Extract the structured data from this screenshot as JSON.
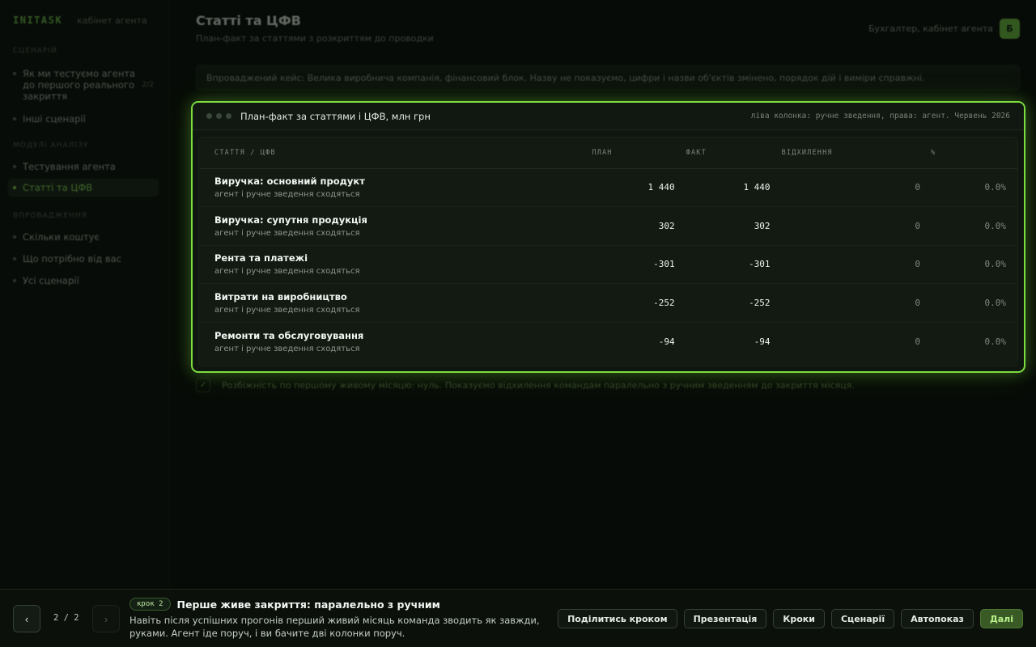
{
  "brand": {
    "logo": "INITASK",
    "subtitle": "кабінет агента"
  },
  "sidebar": {
    "sections": [
      {
        "label": "сценарій"
      },
      {
        "label": "модулі аналізу"
      },
      {
        "label": "впровадження"
      }
    ],
    "items": [
      {
        "label": "Як ми тестуємо агента до першого реального закриття",
        "meta": "2/2"
      },
      {
        "label": "Інші сценарії"
      },
      {
        "label": "Тестування агента"
      },
      {
        "label": "Статті та ЦФВ"
      },
      {
        "label": "Скільки коштує"
      },
      {
        "label": "Що потрібно від вас"
      },
      {
        "label": "Усі сценарії"
      }
    ]
  },
  "header": {
    "title": "Статті та ЦФВ",
    "subtitle": "План-факт за статтями з розкриттям до проводки",
    "user_label": "Бухгалтер, кабінет агента",
    "avatar": "Б"
  },
  "banner": "Впроваджений кейс: Велика виробнича компанія, фінансовий блок. Назву не показуємо, цифри і назви об'єктів змінено, порядок дій і виміри справжні.",
  "card": {
    "title": "План-факт за статтями і ЦФВ, млн грн",
    "note": "ліва колонка: ручне зведення, права: агент. Червень 2026",
    "columns": {
      "name": "СТАТТЯ / ЦФВ",
      "plan": "ПЛАН",
      "fact": "ФАКТ",
      "variance": "ВІДХИЛЕННЯ",
      "percent": "%"
    },
    "rows": [
      {
        "title": "Виручка: основний продукт",
        "sub": "агент і ручне зведення сходяться",
        "plan": "1 440",
        "fact": "1 440",
        "variance": "0",
        "percent": "0.0%"
      },
      {
        "title": "Виручка: супутня продукція",
        "sub": "агент і ручне зведення сходяться",
        "plan": "302",
        "fact": "302",
        "variance": "0",
        "percent": "0.0%"
      },
      {
        "title": "Рента та платежі",
        "sub": "агент і ручне зведення сходяться",
        "plan": "-301",
        "fact": "-301",
        "variance": "0",
        "percent": "0.0%"
      },
      {
        "title": "Витрати на виробництво",
        "sub": "агент і ручне зведення сходяться",
        "plan": "-252",
        "fact": "-252",
        "variance": "0",
        "percent": "0.0%"
      },
      {
        "title": "Ремонти та обслуговування",
        "sub": "агент і ручне зведення сходяться",
        "plan": "-94",
        "fact": "-94",
        "variance": "0",
        "percent": "0.0%"
      }
    ]
  },
  "hint": "Розбіжність по першому живому місяцю: нуль. Показуємо відхилення командам паралельно з ручним зведенням до закриття місяця.",
  "bottom": {
    "prev_symbol": "‹",
    "next_symbol": "›",
    "counter": "2 / 2",
    "badge": "крок 2",
    "step_title": "Перше живе закриття: паралельно з ручним",
    "step_desc": "Навіть після успішних прогонів перший живий місяць команда зводить як завжди, руками. Агент іде поруч, і ви бачите дві колонки поруч.",
    "buttons": {
      "share": "Поділитись кроком",
      "present": "Презентація",
      "steps": "Кроки",
      "scenarios": "Сценарії",
      "autoplay": "Автопоказ",
      "next": "Далі"
    }
  }
}
